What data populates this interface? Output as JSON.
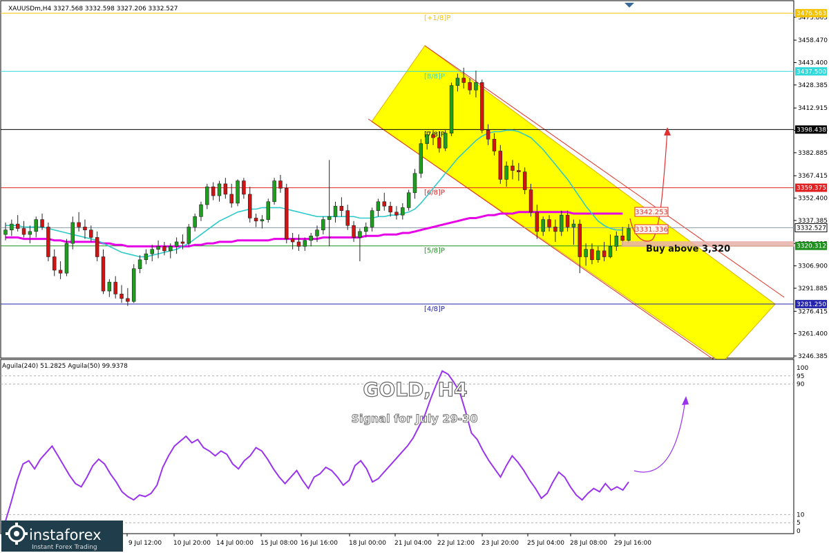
{
  "header": {
    "symbol_info": "XAUUSDm,H4  3327.568 3332.598 3327.206 3332.527"
  },
  "overlay": {
    "title": "GOLD, H4",
    "subtitle": "Signal for July 29-30",
    "buy_note": "Buy above 3,320"
  },
  "indicator": {
    "label": "Aguila(240) 51.2825   Aguila(50) 99.9378",
    "scale_labels": [
      "100",
      "95",
      "90",
      "10",
      "5",
      "0"
    ]
  },
  "logo": {
    "brand": "instaforex",
    "tagline": "Instant Forex Trading"
  },
  "chart_data": [
    {
      "type": "candlestick",
      "symbol": "XAUUSDm",
      "timeframe": "H4",
      "ylim": [
        3246.385,
        3478.0
      ],
      "y_ticks": [
        "3473.865",
        "3458.470",
        "3443.400",
        "3428.385",
        "3412.915",
        "3397.900",
        "3382.885",
        "3367.415",
        "3352.400",
        "3337.385",
        "3321.915",
        "3306.900",
        "3291.885",
        "3276.415",
        "3261.400",
        "3246.385"
      ],
      "x_labels": [
        "9 Jul 12:00",
        "10 Jul 20:00",
        "14 Jul 00:00",
        "15 Jul 08:00",
        "16 Jul 16:00",
        "18 Jul 00:00",
        "21 Jul 04:00",
        "22 Jul 12:00",
        "23 Jul 20:00",
        "25 Jul 04:00",
        "28 Jul 08:00",
        "29 Jul 16:00"
      ],
      "colors": {
        "bull": "#1e9e1e",
        "bear": "#d01414"
      },
      "candles": [
        [
          3328,
          3336,
          3324,
          3331
        ],
        [
          3331,
          3338,
          3327,
          3335
        ],
        [
          3335,
          3341,
          3330,
          3332
        ],
        [
          3332,
          3337,
          3326,
          3328
        ],
        [
          3328,
          3334,
          3322,
          3330
        ],
        [
          3330,
          3340,
          3326,
          3338
        ],
        [
          3338,
          3342,
          3331,
          3333
        ],
        [
          3333,
          3336,
          3310,
          3313
        ],
        [
          3313,
          3318,
          3300,
          3304
        ],
        [
          3304,
          3310,
          3298,
          3302
        ],
        [
          3302,
          3325,
          3300,
          3322
        ],
        [
          3322,
          3340,
          3318,
          3336
        ],
        [
          3336,
          3343,
          3330,
          3333
        ],
        [
          3333,
          3338,
          3325,
          3331
        ],
        [
          3331,
          3334,
          3323,
          3326
        ],
        [
          3326,
          3330,
          3310,
          3313
        ],
        [
          3313,
          3318,
          3288,
          3290
        ],
        [
          3290,
          3298,
          3286,
          3296
        ],
        [
          3296,
          3300,
          3285,
          3288
        ],
        [
          3288,
          3294,
          3282,
          3285
        ],
        [
          3285,
          3292,
          3280,
          3283
        ],
        [
          3283,
          3308,
          3282,
          3305
        ],
        [
          3305,
          3314,
          3302,
          3311
        ],
        [
          3311,
          3318,
          3308,
          3315
        ],
        [
          3315,
          3321,
          3310,
          3318
        ],
        [
          3318,
          3324,
          3312,
          3320
        ],
        [
          3320,
          3323,
          3314,
          3317
        ],
        [
          3317,
          3322,
          3312,
          3320
        ],
        [
          3320,
          3326,
          3315,
          3323
        ],
        [
          3323,
          3328,
          3318,
          3322
        ],
        [
          3322,
          3335,
          3320,
          3333
        ],
        [
          3333,
          3342,
          3330,
          3340
        ],
        [
          3340,
          3350,
          3337,
          3348
        ],
        [
          3348,
          3362,
          3345,
          3360
        ],
        [
          3360,
          3363,
          3351,
          3354
        ],
        [
          3354,
          3364,
          3350,
          3362
        ],
        [
          3362,
          3366,
          3352,
          3355
        ],
        [
          3355,
          3362,
          3346,
          3349
        ],
        [
          3349,
          3365,
          3347,
          3364
        ],
        [
          3364,
          3366,
          3352,
          3355
        ],
        [
          3355,
          3360,
          3336,
          3339
        ],
        [
          3339,
          3342,
          3333,
          3337
        ],
        [
          3337,
          3341,
          3332,
          3338
        ],
        [
          3338,
          3352,
          3336,
          3350
        ],
        [
          3350,
          3366,
          3348,
          3364
        ],
        [
          3364,
          3368,
          3356,
          3359
        ],
        [
          3359,
          3362,
          3322,
          3325
        ],
        [
          3325,
          3329,
          3318,
          3323
        ],
        [
          3323,
          3328,
          3317,
          3320
        ],
        [
          3320,
          3326,
          3317,
          3324
        ],
        [
          3324,
          3329,
          3320,
          3327
        ],
        [
          3327,
          3334,
          3323,
          3331
        ],
        [
          3331,
          3340,
          3328,
          3338
        ],
        [
          3338,
          3378,
          3320,
          3340
        ],
        [
          3340,
          3350,
          3336,
          3347
        ],
        [
          3347,
          3353,
          3340,
          3344
        ],
        [
          3344,
          3348,
          3331,
          3334
        ],
        [
          3334,
          3337,
          3323,
          3326
        ],
        [
          3326,
          3332,
          3310,
          3330
        ],
        [
          3330,
          3336,
          3326,
          3333
        ],
        [
          3333,
          3346,
          3330,
          3344
        ],
        [
          3344,
          3352,
          3340,
          3350
        ],
        [
          3350,
          3356,
          3344,
          3347
        ],
        [
          3347,
          3350,
          3340,
          3343
        ],
        [
          3343,
          3347,
          3338,
          3341
        ],
        [
          3341,
          3349,
          3338,
          3346
        ],
        [
          3346,
          3358,
          3344,
          3356
        ],
        [
          3356,
          3372,
          3352,
          3369
        ],
        [
          3369,
          3392,
          3366,
          3389
        ],
        [
          3389,
          3397,
          3385,
          3395
        ],
        [
          3395,
          3398,
          3388,
          3393
        ],
        [
          3393,
          3397,
          3383,
          3386
        ],
        [
          3386,
          3398,
          3384,
          3396
        ],
        [
          3396,
          3430,
          3394,
          3428
        ],
        [
          3428,
          3436,
          3424,
          3433
        ],
        [
          3433,
          3440,
          3426,
          3430
        ],
        [
          3430,
          3433,
          3422,
          3425
        ],
        [
          3425,
          3438,
          3420,
          3430
        ],
        [
          3430,
          3432,
          3396,
          3398
        ],
        [
          3398,
          3402,
          3388,
          3392
        ],
        [
          3392,
          3396,
          3381,
          3384
        ],
        [
          3384,
          3388,
          3362,
          3365
        ],
        [
          3365,
          3377,
          3360,
          3374
        ],
        [
          3374,
          3378,
          3365,
          3371
        ],
        [
          3371,
          3376,
          3364,
          3370
        ],
        [
          3370,
          3373,
          3355,
          3358
        ],
        [
          3358,
          3362,
          3340,
          3343
        ],
        [
          3343,
          3348,
          3325,
          3330
        ],
        [
          3330,
          3340,
          3327,
          3338
        ],
        [
          3338,
          3341,
          3330,
          3333
        ],
        [
          3333,
          3338,
          3323,
          3330
        ],
        [
          3330,
          3344,
          3327,
          3341
        ],
        [
          3341,
          3344,
          3330,
          3333
        ],
        [
          3333,
          3338,
          3321,
          3335
        ],
        [
          3335,
          3338,
          3302,
          3313
        ],
        [
          3313,
          3322,
          3307,
          3318
        ],
        [
          3318,
          3322,
          3308,
          3311
        ],
        [
          3311,
          3320,
          3309,
          3317
        ],
        [
          3317,
          3323,
          3310,
          3313
        ],
        [
          3313,
          3328,
          3312,
          3320
        ],
        [
          3320,
          3330,
          3317,
          3327
        ],
        [
          3327,
          3333,
          3320,
          3324
        ],
        [
          3324,
          3335,
          3322,
          3332
        ]
      ],
      "series": [
        {
          "name": "Aguila(240)",
          "color": "#e600e6",
          "values": [
            3326,
            3326,
            3326,
            3325,
            3325,
            3325,
            3325,
            3325,
            3324,
            3324,
            3323,
            3323,
            3323,
            3323,
            3323,
            3323,
            3322,
            3322,
            3321,
            3321,
            3320,
            3320,
            3320,
            3320,
            3320,
            3320,
            3320,
            3320,
            3320,
            3320,
            3320,
            3321,
            3321,
            3322,
            3322,
            3323,
            3323,
            3323,
            3324,
            3324,
            3324,
            3324,
            3324,
            3324,
            3325,
            3325,
            3325,
            3325,
            3325,
            3325,
            3325,
            3325,
            3326,
            3326,
            3326,
            3326,
            3326,
            3326,
            3326,
            3327,
            3327,
            3327,
            3328,
            3328,
            3328,
            3329,
            3329,
            3330,
            3331,
            3332,
            3333,
            3334,
            3335,
            3336,
            3337,
            3338,
            3339,
            3339,
            3340,
            3341,
            3341,
            3342,
            3342,
            3342,
            3343,
            3343,
            3343,
            3343,
            3343,
            3343,
            3343,
            3343,
            3343,
            3342,
            3342,
            3342,
            3342,
            3342,
            3342,
            3342,
            3342,
            3342
          ]
        },
        {
          "name": "Aguila(50)",
          "color": "#2fc9c9",
          "values": [
            3334,
            3334,
            3334,
            3333,
            3333,
            3333,
            3333,
            3332,
            3331,
            3330,
            3329,
            3328,
            3327,
            3326,
            3325,
            3324,
            3322,
            3320,
            3318,
            3316,
            3315,
            3314,
            3313,
            3313,
            3314,
            3315,
            3316,
            3317,
            3318,
            3320,
            3322,
            3325,
            3328,
            3331,
            3334,
            3337,
            3339,
            3341,
            3343,
            3344,
            3345,
            3345,
            3346,
            3346,
            3346,
            3346,
            3345,
            3344,
            3343,
            3342,
            3341,
            3340,
            3340,
            3340,
            3340,
            3340,
            3340,
            3340,
            3339,
            3339,
            3339,
            3340,
            3340,
            3341,
            3341,
            3342,
            3343,
            3345,
            3349,
            3354,
            3359,
            3364,
            3369,
            3374,
            3379,
            3383,
            3387,
            3391,
            3394,
            3396,
            3397,
            3397,
            3398,
            3398,
            3397,
            3395,
            3393,
            3389,
            3385,
            3380,
            3375,
            3370,
            3365,
            3359,
            3353,
            3347,
            3342,
            3337,
            3334,
            3332,
            3331,
            3331
          ]
        }
      ],
      "levels": [
        {
          "label": "[+1/8]P",
          "value": 3476.563,
          "price_tag": "3476.563",
          "color": "#f2c200"
        },
        {
          "label": "[8/8]P",
          "value": 3437.5,
          "price_tag": "3437.500",
          "color": "#2fd9d9"
        },
        {
          "label": "[7/8]P",
          "value": 3398.438,
          "price_tag": "3398.438",
          "color": "#000000"
        },
        {
          "label": "[6/8]P",
          "value": 3359.375,
          "price_tag": "3359.375",
          "color": "#e02020"
        },
        {
          "label": "[5/8]P",
          "value": 3320.312,
          "price_tag": "3320.312",
          "color": "#1f8f1f"
        },
        {
          "label": "[4/8]P",
          "value": 3281.25,
          "price_tag": "3281.250",
          "color": "#2222aa"
        }
      ],
      "current_price": {
        "value": 3332.527,
        "label": "3332.527"
      },
      "annotations": [
        {
          "label": "3342.253",
          "value": 3342.253
        },
        {
          "label": "3331.336",
          "value": 3331.336
        }
      ]
    },
    {
      "type": "line",
      "name": "Aguila oscillator",
      "ylim": [
        0,
        100
      ],
      "y_ticks": [
        100,
        95,
        90,
        10,
        5,
        0
      ],
      "color": "#9933ee",
      "values": [
        6,
        18,
        31,
        41,
        43,
        38,
        44,
        48,
        52,
        46,
        40,
        34,
        29,
        27,
        33,
        40,
        44,
        41,
        35,
        30,
        24,
        21,
        19,
        22,
        21,
        23,
        28,
        39,
        46,
        52,
        55,
        58,
        54,
        56,
        51,
        49,
        46,
        49,
        47,
        41,
        38,
        43,
        46,
        51,
        49,
        44,
        38,
        33,
        29,
        33,
        37,
        31,
        26,
        33,
        35,
        39,
        37,
        33,
        28,
        31,
        40,
        43,
        38,
        30,
        32,
        36,
        40,
        44,
        48,
        52,
        57,
        64,
        71,
        81,
        90,
        98,
        96,
        91,
        85,
        73,
        60,
        56,
        49,
        43,
        38,
        33,
        40,
        46,
        42,
        37,
        31,
        26,
        20,
        23,
        30,
        36,
        33,
        27,
        22,
        19,
        23,
        26,
        24,
        29,
        25,
        27,
        25,
        30
      ]
    }
  ]
}
